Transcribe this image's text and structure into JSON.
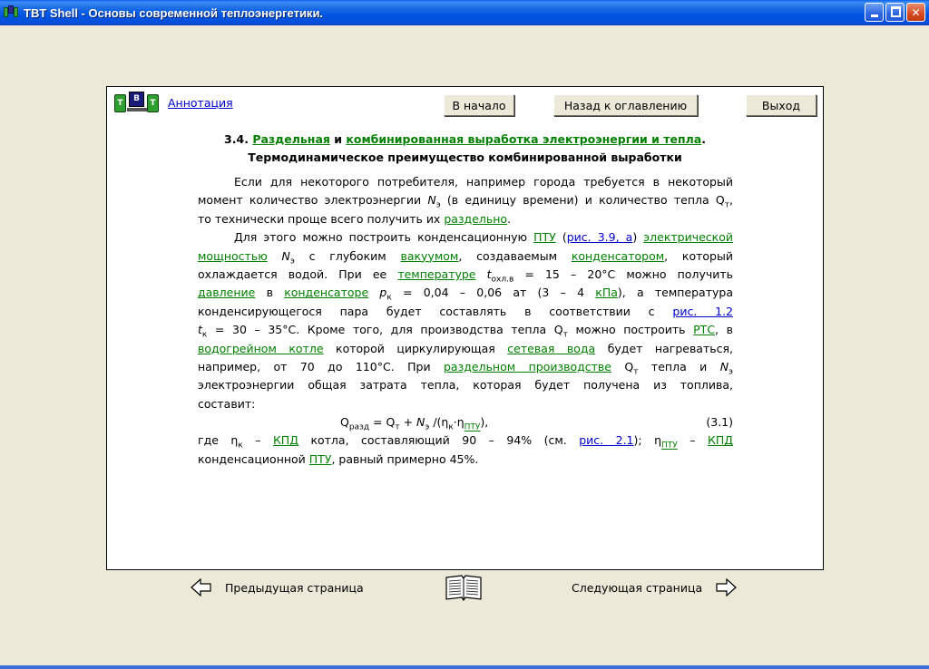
{
  "window": {
    "title": "TBT Shell - Основы современной теплоэнергетики."
  },
  "header": {
    "annotation_link": "Аннотация",
    "home_button": "В начало",
    "toc_button": "Назад к оглавлению",
    "exit_button": "Выход"
  },
  "section": {
    "number": "3.4.",
    "link1": "Раздельная",
    "and": "и",
    "link2": "комбинированная выработка электроэнергии и тепла",
    "subtitle": "Термодинамическое преимущество комбинированной выработки"
  },
  "nav": {
    "prev_label": "Предыдущая страница",
    "next_label": "Следующая страница"
  }
}
